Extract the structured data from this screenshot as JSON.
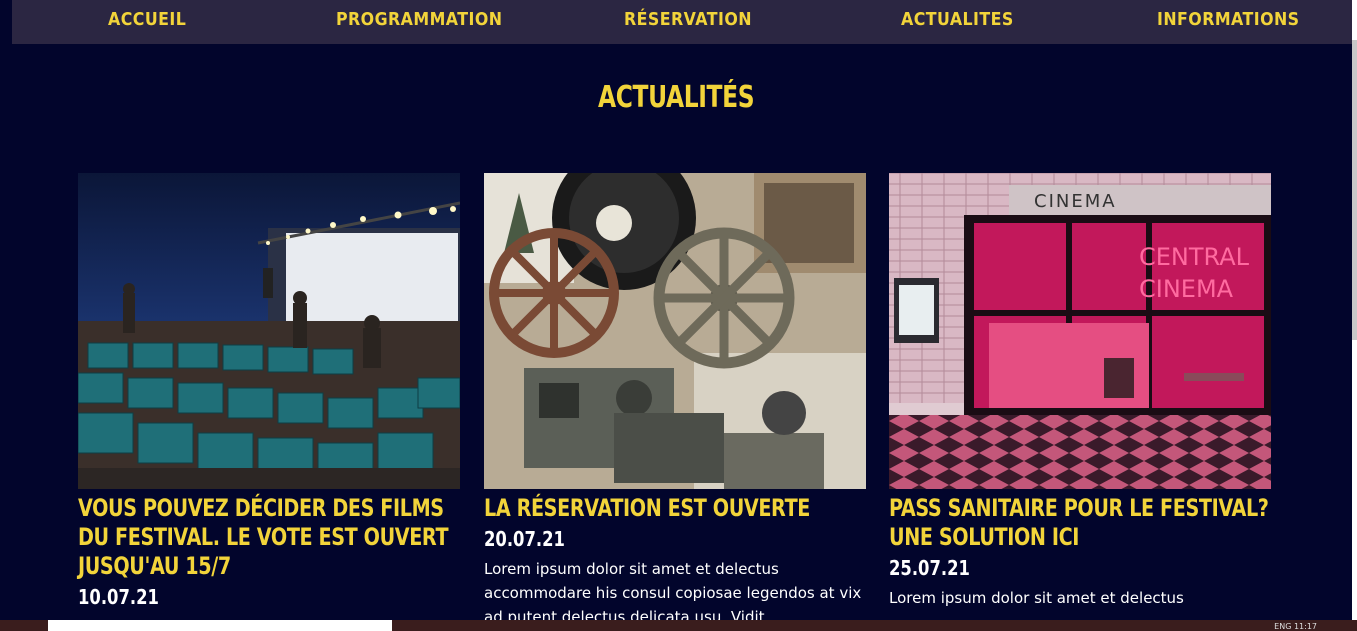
{
  "nav": {
    "items": [
      {
        "label": "ACCUEIL"
      },
      {
        "label": "PROGRAMMATION"
      },
      {
        "label": "RÉSERVATION"
      },
      {
        "label": "ACTUALITES"
      },
      {
        "label": "INFORMATIONS"
      }
    ]
  },
  "section": {
    "title": "ACTUALITÉS"
  },
  "cards": [
    {
      "title": "VOUS POUVEZ DÉCIDER DES FILMS DU FESTIVAL. LE VOTE EST OUVERT JUSQU'AU 15/7",
      "date": "10.07.21",
      "body": ""
    },
    {
      "title": "LA RÉSERVATION EST OUVERTE",
      "date": "20.07.21",
      "body": "Lorem ipsum dolor sit amet et delectus accommodare his consul copiosae legendos at vix ad putent delectus delicata usu. Vidit"
    },
    {
      "title": "PASS SANITAIRE POUR LE FESTIVAL? UNE SOLUTION ICI",
      "date": "25.07.21",
      "body": "Lorem ipsum dolor sit amet et delectus"
    }
  ],
  "images": {
    "card1": {
      "sign": ""
    },
    "card3": {
      "sign": "CINEMA",
      "neon1": "CENTRAL",
      "neon2": "CINEMA"
    }
  },
  "taskbar": {
    "tray": "ENG   11:17"
  },
  "colors": {
    "background": "#02052c",
    "nav_bg": "#2b2642",
    "accent": "#f2d43a",
    "text": "#ffffff"
  }
}
